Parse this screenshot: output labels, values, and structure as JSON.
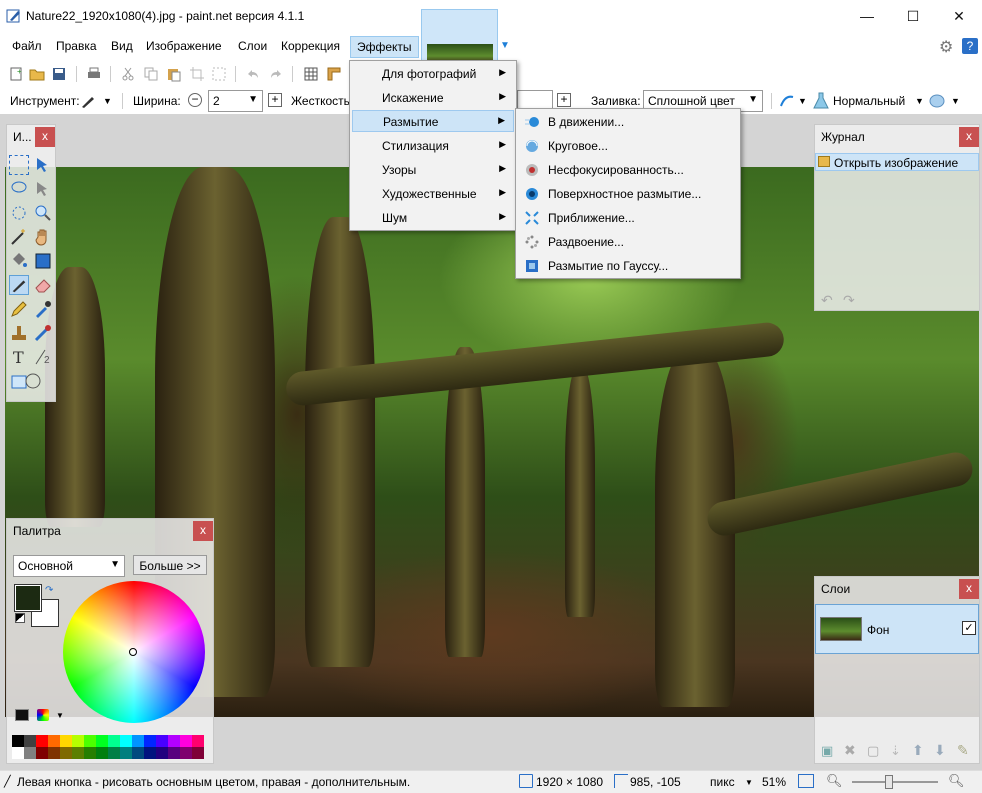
{
  "window": {
    "title": "Nature22_1920x1080(4).jpg - paint.net версия 4.1.1",
    "minimize_glyph": "—",
    "maximize_glyph": "☐",
    "close_glyph": "✕"
  },
  "menubar": {
    "items": [
      "Файл",
      "Правка",
      "Вид",
      "Изображение",
      "Слои",
      "Коррекция",
      "Эффекты"
    ]
  },
  "options": {
    "tool_label": "Инструмент:",
    "width_label": "Ширина:",
    "width_value": "2",
    "hardness_label": "Жесткость",
    "fill_label": "Заливка:",
    "fill_value": "Сплошной цвет",
    "blend_mode": "Нормальный"
  },
  "tools_panel": {
    "title": "И...",
    "close": "x"
  },
  "effects_menu": {
    "items": [
      {
        "label": "Для фотографий"
      },
      {
        "label": "Искажение"
      },
      {
        "label": "Размытие"
      },
      {
        "label": "Стилизация"
      },
      {
        "label": "Узоры"
      },
      {
        "label": "Художественные"
      },
      {
        "label": "Шум"
      }
    ],
    "submenu_arrow": "▶"
  },
  "blur_submenu": {
    "items": [
      {
        "label": "В движении...",
        "icon": "motion-blur-icon"
      },
      {
        "label": "Круговое...",
        "icon": "radial-blur-icon"
      },
      {
        "label": "Несфокусированность...",
        "icon": "unfocus-icon"
      },
      {
        "label": "Поверхностное размытие...",
        "icon": "surface-blur-icon"
      },
      {
        "label": "Приближение...",
        "icon": "zoom-blur-icon"
      },
      {
        "label": "Раздвоение...",
        "icon": "fragment-icon"
      },
      {
        "label": "Размытие по Гауссу...",
        "icon": "gaussian-blur-icon"
      }
    ]
  },
  "history_panel": {
    "title": "Журнал",
    "close": "x",
    "entries": [
      "Открыть изображение"
    ]
  },
  "palette_panel": {
    "title": "Палитра",
    "close": "x",
    "mode": "Основной",
    "more_button": "Больше >>"
  },
  "layers_panel": {
    "title": "Слои",
    "close": "x",
    "layers": [
      {
        "name": "Фон",
        "visible": true
      }
    ]
  },
  "statusbar": {
    "hint": "Левая кнопка - рисовать основным цветом, правая - дополнительным.",
    "image_size": "1920 × 1080",
    "cursor_pos": "985, -105",
    "units": "пикс",
    "zoom": "51%"
  },
  "colors": {
    "accent": "#1e7fd8",
    "menu_highlight": "#cde4f7",
    "close_red": "#c85050",
    "primary_color": "#1c2a12"
  }
}
